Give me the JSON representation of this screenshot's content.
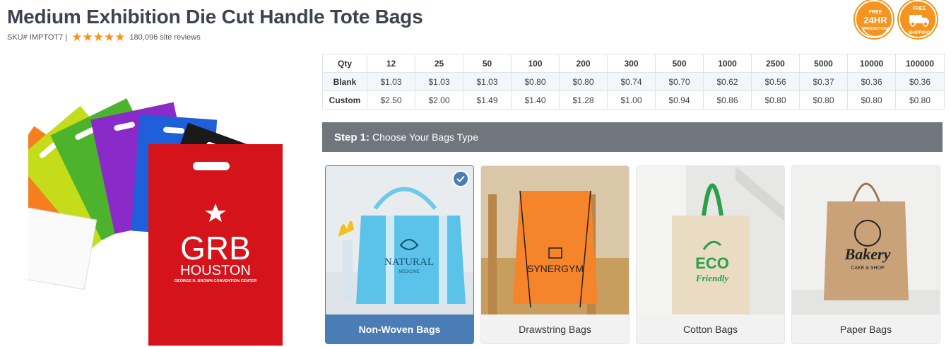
{
  "product": {
    "title": "Medium Exhibition Die Cut Handle Tote Bags",
    "sku": "SKU# IMPTOT7 |",
    "rating_stars": 5,
    "reviews": "180,096 site reviews",
    "hero_print": {
      "logo_main": "GRB",
      "logo_city": "HOUSTON",
      "logo_sub": "GEORGE R. BROWN CONVENTION CENTER"
    }
  },
  "badges": [
    {
      "top": "FREE",
      "main": "24HR",
      "bottom": "PRODUCTION",
      "icon": "24hr-production-icon"
    },
    {
      "top": "FREE",
      "bottom": "SHIPPING",
      "icon": "truck-icon"
    }
  ],
  "price_table": {
    "header_label": "Qty",
    "quantities": [
      "12",
      "25",
      "50",
      "100",
      "200",
      "300",
      "500",
      "1000",
      "2500",
      "5000",
      "10000",
      "100000"
    ],
    "rows": [
      {
        "label": "Blank",
        "prices": [
          "$1.03",
          "$1.03",
          "$1.03",
          "$0.80",
          "$0.80",
          "$0.74",
          "$0.70",
          "$0.62",
          "$0.56",
          "$0.37",
          "$0.36",
          "$0.36"
        ]
      },
      {
        "label": "Custom",
        "prices": [
          "$2.50",
          "$2.00",
          "$1.49",
          "$1.40",
          "$1.28",
          "$1.00",
          "$0.94",
          "$0.86",
          "$0.80",
          "$0.80",
          "$0.80",
          "$0.80"
        ]
      }
    ]
  },
  "step": {
    "number": "Step 1:",
    "text": "Choose Your Bags Type"
  },
  "bag_types": [
    {
      "label": "Non-Woven Bags",
      "selected": true,
      "print": "NATURAL",
      "print_sub": "MEDICINE"
    },
    {
      "label": "Drawstring Bags",
      "selected": false,
      "print": "SYNERGYM"
    },
    {
      "label": "Cotton Bags",
      "selected": false,
      "print": "ECO",
      "print_sub": "Friendly"
    },
    {
      "label": "Paper Bags",
      "selected": false,
      "print": "Bakery",
      "print_sub": "CAKE & SHOP"
    }
  ],
  "colors": {
    "accent": "#4a7db5",
    "badge": "#f5941e",
    "step_bar": "#6f767d",
    "title": "#3d4450"
  }
}
